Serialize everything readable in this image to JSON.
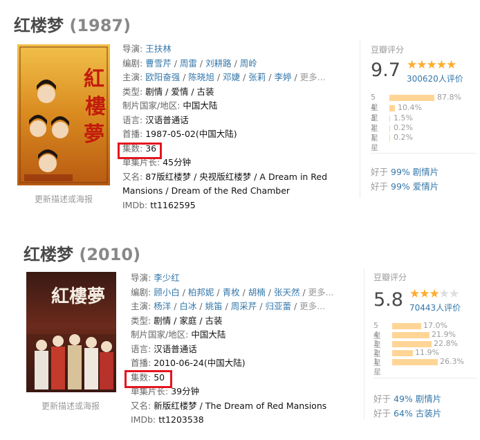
{
  "movies": [
    {
      "title": "红楼梦",
      "year": "(1987)",
      "poster_caption": "更新描述或海报",
      "director_label": "导演:",
      "directors": [
        "王扶林"
      ],
      "writer_label": "编剧:",
      "writers": [
        "曹雪芹",
        "周雷",
        "刘耕路",
        "周岭"
      ],
      "cast_label": "主演:",
      "cast": [
        "欧阳奋强",
        "陈晓旭",
        "邓婕",
        "张莉",
        "李婷"
      ],
      "more": "更多...",
      "genre_label": "类型:",
      "genre": "剧情 / 爱情 / 古装",
      "country_label": "制片国家/地区:",
      "country": "中国大陆",
      "language_label": "语言:",
      "language": "汉语普通话",
      "premiere_label": "首播:",
      "premiere": "1987-05-02(中国大陆)",
      "episodes_label": "集数:",
      "episodes": "36",
      "runtime_label": "单集片长:",
      "runtime": "45分钟",
      "aka_label": "又名:",
      "aka_line1": "87版红楼梦 / 央视版红楼梦 / A Dream in Red",
      "aka_line2": "Mansions / Dream of the Red Chamber",
      "imdb_label": "IMDb:",
      "imdb": "tt1162595",
      "rating": {
        "header": "豆瓣评分",
        "score": "9.7",
        "stars": 5,
        "votes": "300620人评价",
        "dist": [
          {
            "label": "5星",
            "pct": "87.8%",
            "value": 87.8
          },
          {
            "label": "4星",
            "pct": "10.4%",
            "value": 10.4
          },
          {
            "label": "3星",
            "pct": "1.5%",
            "value": 1.5
          },
          {
            "label": "2星",
            "pct": "0.2%",
            "value": 0.2
          },
          {
            "label": "1星",
            "pct": "0.2%",
            "value": 0.2
          }
        ],
        "better": [
          {
            "prefix": "好于",
            "pct": "99%",
            "genre": "剧情片"
          },
          {
            "prefix": "好于",
            "pct": "99%",
            "genre": "爱情片"
          }
        ]
      }
    },
    {
      "title": "红楼梦",
      "year": "(2010)",
      "poster_caption": "更新描述或海报",
      "director_label": "导演:",
      "directors": [
        "李少红"
      ],
      "writer_label": "编剧:",
      "writers": [
        "顾小白",
        "柏邦妮",
        "青枚",
        "胡楠",
        "张天然"
      ],
      "cast_label": "主演:",
      "cast": [
        "杨洋",
        "白冰",
        "姚笛",
        "周采芹",
        "归亚蕾"
      ],
      "more": "更多...",
      "genre_label": "类型:",
      "genre": "剧情 / 家庭 / 古装",
      "country_label": "制片国家/地区:",
      "country": "中国大陆",
      "language_label": "语言:",
      "language": "汉语普通话",
      "premiere_label": "首播:",
      "premiere": "2010-06-24(中国大陆)",
      "episodes_label": "集数:",
      "episodes": "50",
      "runtime_label": "单集片长:",
      "runtime": "39分钟",
      "aka_label": "又名:",
      "aka_line1": "新版红楼梦 / The Dream of Red Mansions",
      "aka_line2": "",
      "imdb_label": "IMDb:",
      "imdb": "tt1203538",
      "rating": {
        "header": "豆瓣评分",
        "score": "5.8",
        "stars": 3,
        "votes": "70443人评价",
        "dist": [
          {
            "label": "5星",
            "pct": "17.0%",
            "value": 17.0
          },
          {
            "label": "4星",
            "pct": "21.9%",
            "value": 21.9
          },
          {
            "label": "3星",
            "pct": "22.8%",
            "value": 22.8
          },
          {
            "label": "2星",
            "pct": "11.9%",
            "value": 11.9
          },
          {
            "label": "1星",
            "pct": "26.3%",
            "value": 26.3
          }
        ],
        "better": [
          {
            "prefix": "好于",
            "pct": "49%",
            "genre": "剧情片"
          },
          {
            "prefix": "好于",
            "pct": "64%",
            "genre": "古装片"
          }
        ]
      }
    }
  ],
  "colors": {
    "link": "#3377aa",
    "highlight": "#e4141e",
    "star": "#ffac2d",
    "bar": "#ffd596"
  }
}
